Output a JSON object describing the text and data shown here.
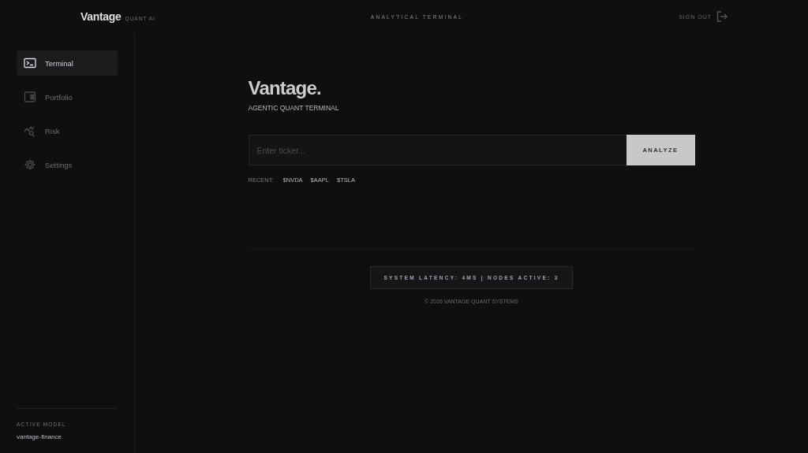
{
  "header": {
    "brand": "Vantage",
    "brand_tag": "QUANT AI",
    "title": "ANALYTICAL TERMINAL",
    "sign_out": "SIGN OUT"
  },
  "sidebar": {
    "items": [
      {
        "label": "Terminal",
        "selected": true
      },
      {
        "label": "Portfolio",
        "selected": false
      },
      {
        "label": "Risk",
        "selected": false
      },
      {
        "label": "Settings",
        "selected": false
      }
    ],
    "footer": {
      "label": "ACTIVE MODEL",
      "value": "vantage-finance"
    }
  },
  "main": {
    "title": "Vantage.",
    "subtitle": "AGENTIC QUANT TERMINAL",
    "search": {
      "placeholder": "Enter ticker..."
    },
    "button": "ANALYZE",
    "recent_label": "RECENT:",
    "recent": [
      "$NVDA",
      "$AAPL",
      "$TSLA"
    ],
    "status": "SYSTEM LATENCY: 4MS | NODES ACTIVE: 3",
    "copyright": "© 2026 VANTAGE QUANT SYSTEMS"
  }
}
